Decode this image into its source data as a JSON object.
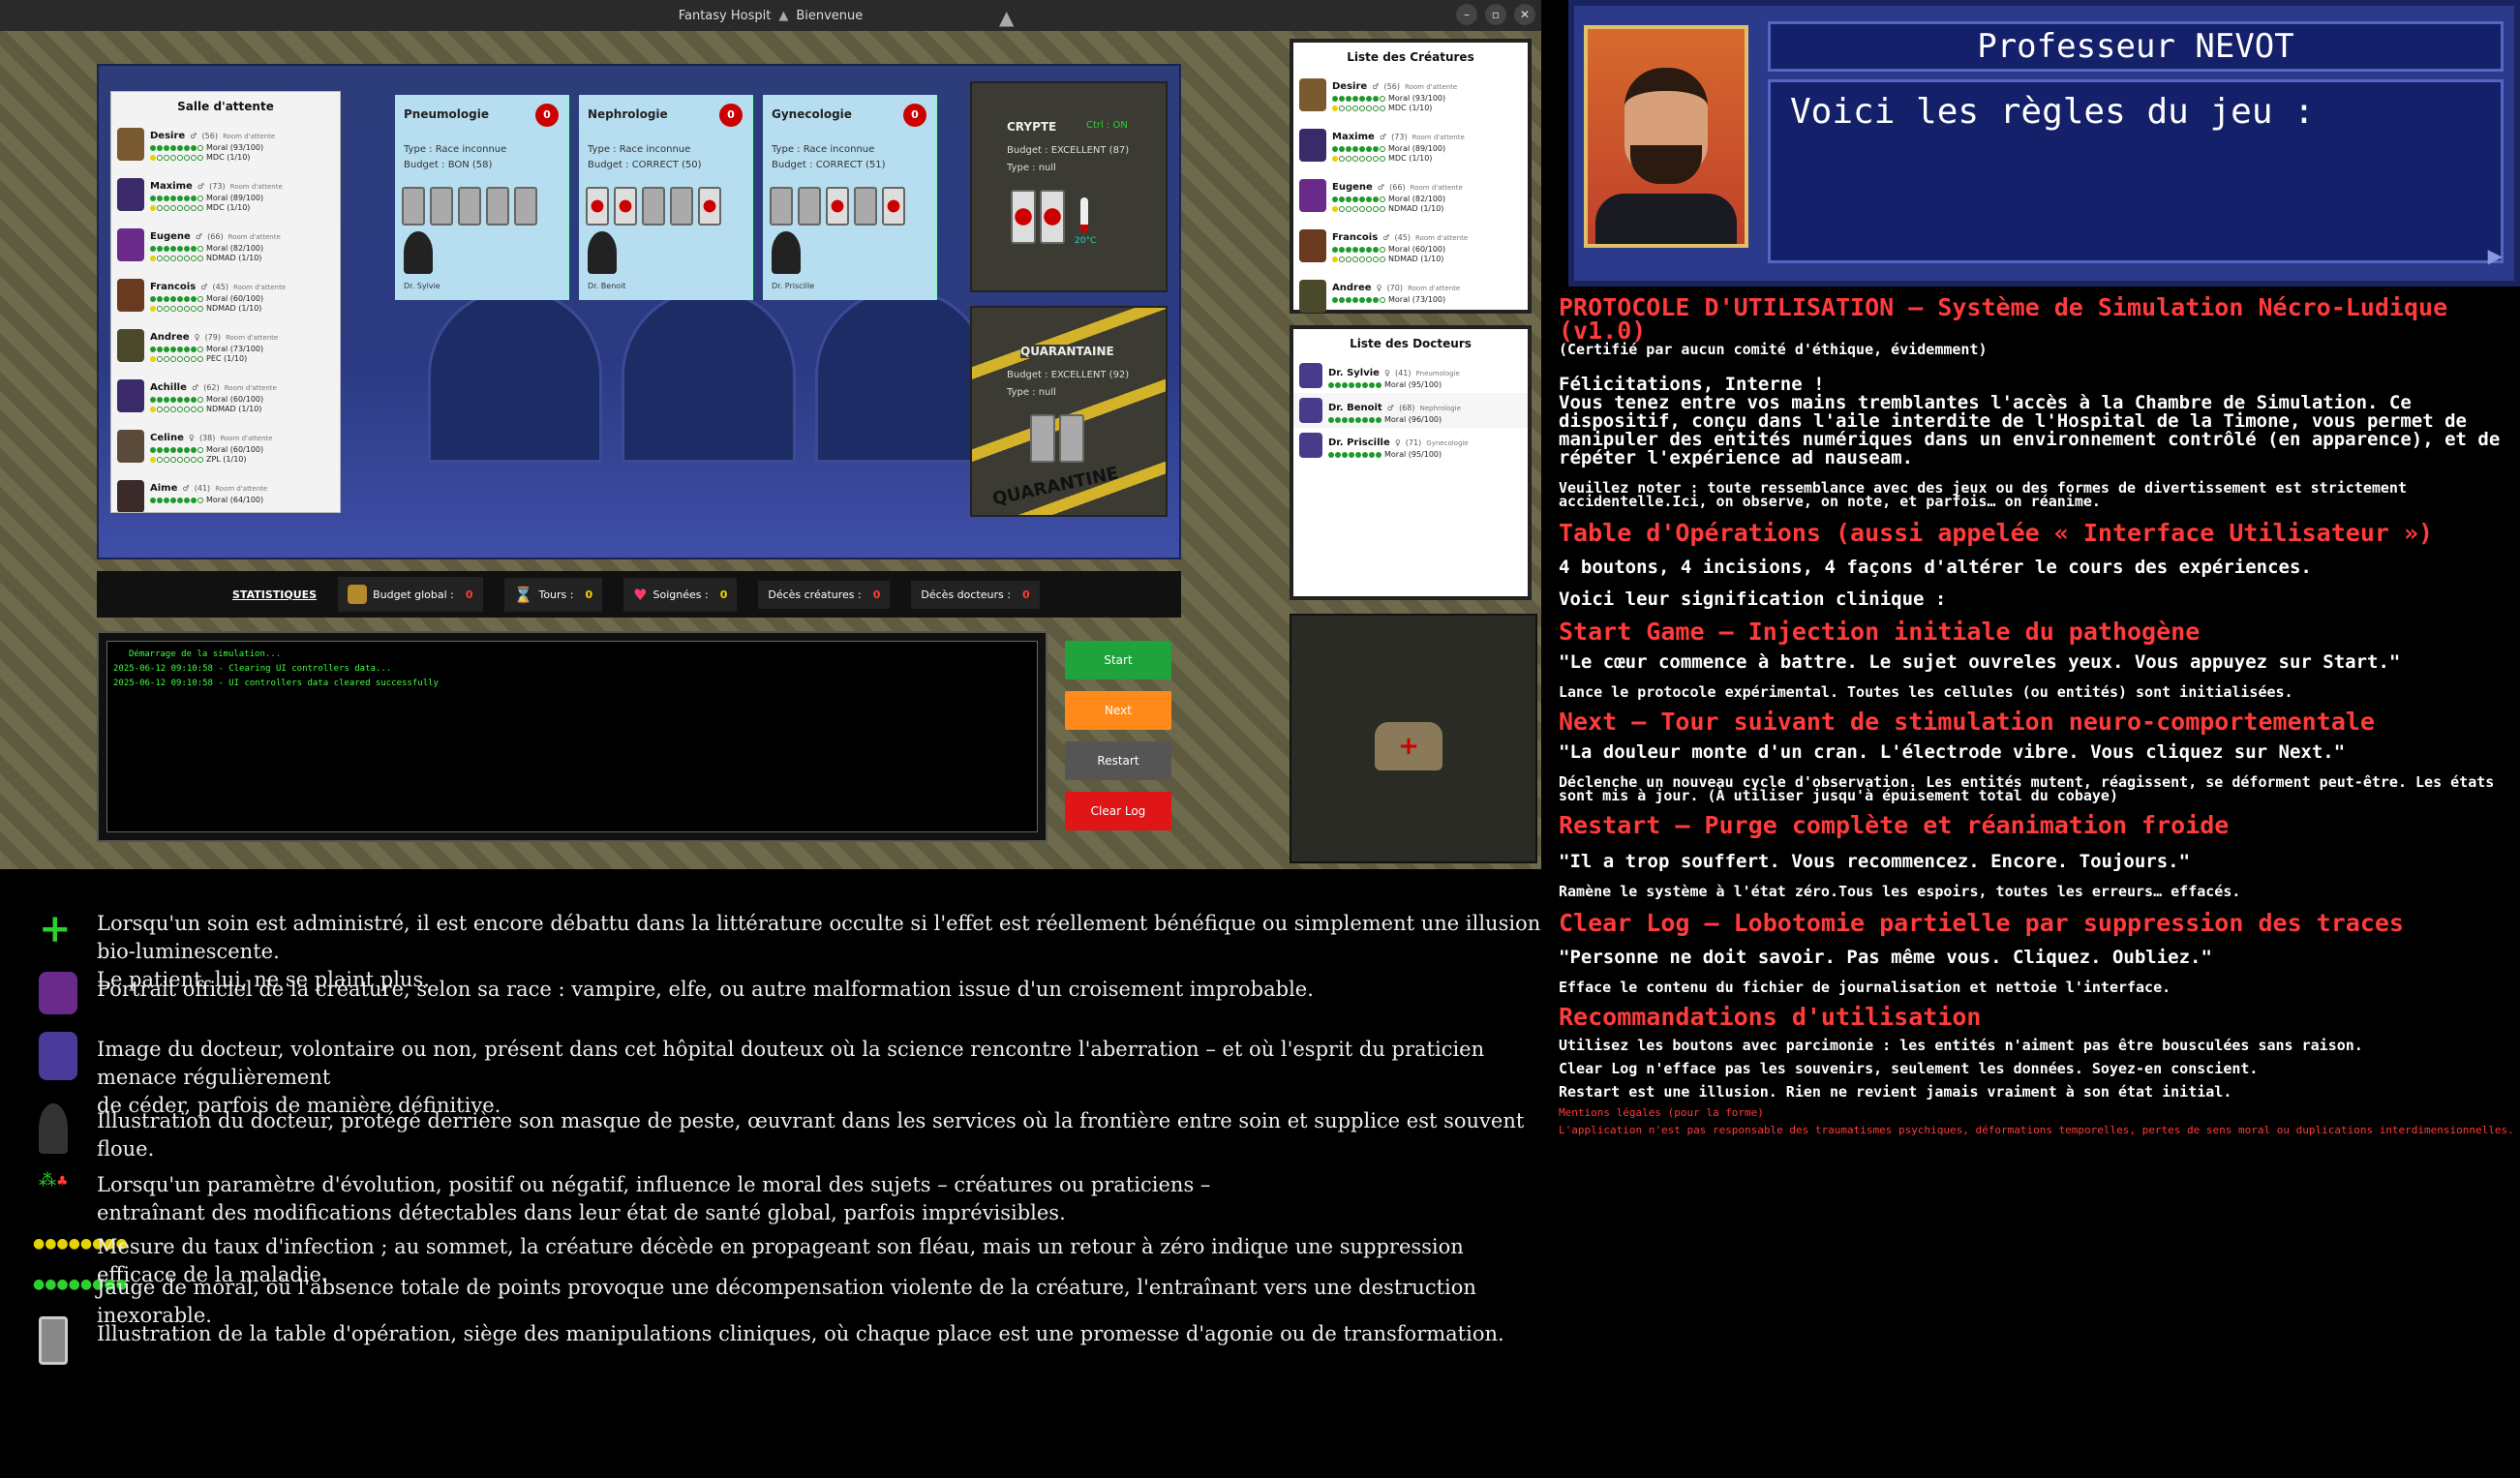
{
  "window": {
    "title": "Fantasy Hospit",
    "title2": "Bienvenue"
  },
  "waiting_room": {
    "title": "Salle d'attente",
    "creatures": [
      {
        "name": "Desire",
        "sex": "♂",
        "age": "(56)",
        "room": "Room d'attente",
        "moral": "Moral (93/100)",
        "disease": "MDC (1/10)",
        "color": "#7a5a30"
      },
      {
        "name": "Maxime",
        "sex": "♂",
        "age": "(73)",
        "room": "Room d'attente",
        "moral": "Moral (89/100)",
        "disease": "MDC (1/10)",
        "color": "#3a2a6a"
      },
      {
        "name": "Eugene",
        "sex": "♂",
        "age": "(66)",
        "room": "Room d'attente",
        "moral": "Moral (82/100)",
        "disease": "NDMAD (1/10)",
        "color": "#6a2a8a"
      },
      {
        "name": "Francois",
        "sex": "♂",
        "age": "(45)",
        "room": "Room d'attente",
        "moral": "Moral (60/100)",
        "disease": "NDMAD (1/10)",
        "color": "#6a3a20"
      },
      {
        "name": "Andree",
        "sex": "♀",
        "age": "(79)",
        "room": "Room d'attente",
        "moral": "Moral (73/100)",
        "disease": "PEC (1/10)",
        "color": "#4a4a2a"
      },
      {
        "name": "Achille",
        "sex": "♂",
        "age": "(62)",
        "room": "Room d'attente",
        "moral": "Moral (60/100)",
        "disease": "NDMAD (1/10)",
        "color": "#3a2a6a"
      },
      {
        "name": "Celine",
        "sex": "♀",
        "age": "(38)",
        "room": "Room d'attente",
        "moral": "Moral (60/100)",
        "disease": "ZPL (1/10)",
        "color": "#5a4a3a"
      },
      {
        "name": "Aime",
        "sex": "♂",
        "age": "(41)",
        "room": "Room d'attente",
        "moral": "Moral (64/100)",
        "disease": "",
        "color": "#3a2a2a"
      }
    ]
  },
  "services": [
    {
      "name": "Pneumologie",
      "count": "0",
      "type": "Type : Race inconnue",
      "budget": "Budget : BON (58)",
      "doctor": "Dr. Sylvie",
      "beds": [
        0,
        0,
        0,
        0,
        0
      ]
    },
    {
      "name": "Nephrologie",
      "count": "0",
      "type": "Type : Race inconnue",
      "budget": "Budget : CORRECT (50)",
      "doctor": "Dr. Benoit",
      "beds": [
        1,
        1,
        0,
        0,
        1
      ]
    },
    {
      "name": "Gynecologie",
      "count": "0",
      "type": "Type : Race inconnue",
      "budget": "Budget : CORRECT (51)",
      "doctor": "Dr. Priscille",
      "beds": [
        0,
        0,
        1,
        0,
        1
      ]
    }
  ],
  "crypte": {
    "title": "CRYPTE",
    "status": "Ctrl : ON",
    "budget": "Budget : EXCELLENT (87)",
    "type": "Type : null",
    "temp": "20°C"
  },
  "quarantaine": {
    "title": "QUARANTAINE",
    "budget": "Budget : EXCELLENT (92)",
    "type": "Type : null",
    "tape": "QUARANTINE"
  },
  "stats": {
    "title": "STATISTIQUES",
    "budget_label": "Budget global :",
    "budget_value": "0",
    "turns_label": "Tours :",
    "turns_value": "0",
    "healed_label": "Soignées :",
    "healed_value": "0",
    "creature_deaths_label": "Décès créatures :",
    "creature_deaths_value": "0",
    "doctor_deaths_label": "Décès docteurs :",
    "doctor_deaths_value": "0"
  },
  "log": [
    "Démarrage de la simulation...",
    "2025-06-12 09:10:58 - Clearing UI controllers data...",
    "2025-06-12 09:10:58 - UI controllers data cleared successfully"
  ],
  "controls": {
    "start": "Start",
    "next": "Next",
    "restart": "Restart",
    "clear": "Clear Log",
    "colors": {
      "start": "#1fa33a",
      "next": "#ff8a1a",
      "restart": "#555555",
      "clear": "#e01515"
    }
  },
  "creatures_list": {
    "title": "Liste des Créatures",
    "items": [
      {
        "name": "Desire",
        "sex": "♂",
        "age": "(56)",
        "room": "Room d'attente",
        "moral": "Moral (93/100)",
        "disease": "MDC (1/10)",
        "color": "#7a5a30"
      },
      {
        "name": "Maxime",
        "sex": "♂",
        "age": "(73)",
        "room": "Room d'attente",
        "moral": "Moral (89/100)",
        "disease": "MDC (1/10)",
        "color": "#3a2a6a"
      },
      {
        "name": "Eugene",
        "sex": "♂",
        "age": "(66)",
        "room": "Room d'attente",
        "moral": "Moral (82/100)",
        "disease": "NDMAD (1/10)",
        "color": "#6a2a8a"
      },
      {
        "name": "Francois",
        "sex": "♂",
        "age": "(45)",
        "room": "Room d'attente",
        "moral": "Moral (60/100)",
        "disease": "NDMAD (1/10)",
        "color": "#6a3a20"
      },
      {
        "name": "Andree",
        "sex": "♀",
        "age": "(70)",
        "room": "Room d'attente",
        "moral": "Moral (73/100)",
        "disease": "",
        "color": "#4a4a2a"
      }
    ]
  },
  "doctors_list": {
    "title": "Liste des Docteurs",
    "items": [
      {
        "name": "Dr. Sylvie",
        "sex": "♀",
        "age": "(41)",
        "service": "Pneumologie",
        "moral": "Moral (95/100)"
      },
      {
        "name": "Dr. Benoit",
        "sex": "♂",
        "age": "(68)",
        "service": "Nephrologie",
        "moral": "Moral (96/100)"
      },
      {
        "name": "Dr. Priscille",
        "sex": "♀",
        "age": "(71)",
        "service": "Gynecologie",
        "moral": "Moral (95/100)"
      }
    ]
  },
  "legend": [
    {
      "icon": "heal-cross-icon",
      "text": "Lorsqu'un soin est administré, il est encore débattu dans la littérature occulte si l'effet est réellement bénéfique ou simplement une illusion bio-luminescente.\nLe patient, lui, ne se plaint plus."
    },
    {
      "icon": "creature-portrait-icon",
      "text": "Portrait officiel de la créature, selon sa race : vampire, elfe, ou autre malformation issue d'un croisement improbable."
    },
    {
      "icon": "doctor-portrait-icon",
      "text": "Image du docteur, volontaire ou non, présent dans cet hôpital douteux où la science rencontre l'aberration – et où l'esprit du praticien menace régulièrement\nde céder, parfois de manière définitive."
    },
    {
      "icon": "plague-doctor-icon",
      "text": "Illustration du docteur, protégé derrière son masque de peste, œuvrant dans les services où la frontière entre soin et supplice est souvent floue."
    },
    {
      "icon": "evolution-icon",
      "text": "Lorsqu'un paramètre d'évolution, positif ou négatif, influence le moral des sujets – créatures ou praticiens –\nentraînant des modifications détectables dans leur état de santé global, parfois imprévisibles."
    },
    {
      "icon": "infection-gauge-icon",
      "text": "Mesure du taux d'infection ; au sommet, la créature décède en propageant son fléau, mais un retour à zéro indique une suppression efficace de la maladie."
    },
    {
      "icon": "moral-gauge-icon",
      "text": "Jauge de moral, où l'absence totale de points provoque une décompensation violente de la créature, l'entraînant vers une destruction inexorable."
    },
    {
      "icon": "operating-table-icon",
      "text": "Illustration de la table d'opération, siège des manipulations cliniques, où chaque place est une promesse d'agonie ou de transformation."
    }
  ],
  "npc": {
    "name": "Professeur NEVOT",
    "text": "Voici les règles du jeu :"
  },
  "doc": {
    "title": "PROTOCOLE D'UTILISATION — Système de Simulation Nécro-Ludique (v1.0)",
    "subtitle": "(Certifié par aucun comité d'éthique, évidemment)",
    "intro_head": "Félicitations, Interne !",
    "intro": "Vous tenez entre vos mains tremblantes l'accès à la Chambre de Simulation. Ce dispositif, conçu dans l'aile interdite de l'Hospital de la Timone, vous permet de manipuler des entités numériques dans un environnement contrôlé (en apparence), et de répéter l'expérience ad nauseam.",
    "note": "Veuillez noter : toute ressemblance avec des jeux ou des formes de divertissement est strictement accidentelle.Ici, on observe, on note, et parfois… on réanime.",
    "table_title": "Table d'Opérations (aussi appelée « Interface Utilisateur »)",
    "table_intro": "4 boutons, 4 incisions, 4 façons d'altérer le cours des expériences.",
    "meaning": "Voici leur signification clinique :",
    "start_title": "Start Game — Injection initiale du pathogène",
    "start_quote": "\"Le cœur commence à battre. Le sujet ouvreles yeux. Vous appuyez sur Start.\"",
    "start_desc": "Lance le protocole expérimental. Toutes les cellules (ou entités) sont initialisées.",
    "next_title": "Next — Tour suivant de stimulation neuro-comportementale",
    "next_quote": "\"La douleur monte d'un cran. L'électrode vibre. Vous cliquez sur Next.\"",
    "next_desc": "Déclenche un nouveau cycle d'observation. Les entités mutent, réagissent, se déforment peut-être. Les états sont mis à jour. (À utiliser jusqu'à épuisement total du cobaye)",
    "restart_title": "Restart — Purge complète et réanimation froide",
    "restart_quote": "\"Il a trop souffert. Vous recommencez. Encore. Toujours.\"",
    "restart_desc": "Ramène le système à l'état zéro.Tous les espoirs, toutes les erreurs… effacés.",
    "clear_title": "Clear Log — Lobotomie partielle par suppression des traces",
    "clear_quote": "\"Personne ne doit savoir. Pas même vous. Cliquez. Oubliez.\"",
    "clear_desc": "Efface le contenu du fichier de journalisation et nettoie l'interface.",
    "reco_title": "Recommandations d'utilisation",
    "reco1": "Utilisez les boutons avec parcimonie : les entités n'aiment pas être bousculées sans raison.",
    "reco2": "Clear Log n'efface pas les souvenirs, seulement les données. Soyez-en conscient.",
    "reco3": "Restart est une illusion. Rien ne revient jamais vraiment à son état initial.",
    "legal_title": "Mentions légales (pour la forme)",
    "legal": "L'application n'est pas responsable des traumatismes psychiques, déformations temporelles, pertes de sens moral ou duplications interdimensionnelles."
  }
}
